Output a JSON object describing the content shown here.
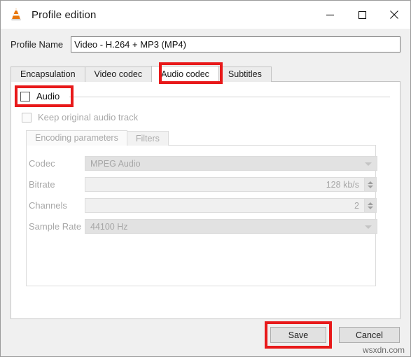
{
  "window": {
    "title": "Profile edition",
    "app_icon": "vlc-cone-icon",
    "controls": {
      "minimize": "minimize-icon",
      "maximize": "maximize-icon",
      "close": "close-icon"
    }
  },
  "profile": {
    "label": "Profile Name",
    "value": "Video - H.264 + MP3 (MP4)",
    "placeholder": ""
  },
  "tabs": [
    {
      "label": "Encapsulation",
      "active": false
    },
    {
      "label": "Video codec",
      "active": false
    },
    {
      "label": "Audio codec",
      "active": true
    },
    {
      "label": "Subtitles",
      "active": false
    }
  ],
  "audio_group": {
    "checkbox_label": "Audio",
    "checked": false,
    "keep_original_label": "Keep original audio track",
    "keep_original_checked": false,
    "keep_original_disabled": true
  },
  "inner_tabs": [
    {
      "label": "Encoding parameters",
      "active": true
    },
    {
      "label": "Filters",
      "active": false
    }
  ],
  "fields": {
    "codec": {
      "label": "Codec",
      "value": "MPEG Audio",
      "type": "combobox",
      "disabled": true
    },
    "bitrate": {
      "label": "Bitrate",
      "value": "128 kb/s",
      "type": "spinbox",
      "disabled": true
    },
    "channels": {
      "label": "Channels",
      "value": "2",
      "type": "spinbox",
      "disabled": true
    },
    "sample_rate": {
      "label": "Sample Rate",
      "value": "44100 Hz",
      "type": "combobox",
      "disabled": true
    }
  },
  "footer": {
    "save_label": "Save",
    "cancel_label": "Cancel"
  },
  "watermark": "wsxdn.com",
  "colors": {
    "highlight": "#e8191a",
    "window_bg": "#f0f0f0",
    "panel_bg": "#ffffff",
    "disabled_text": "#a8a8a8"
  }
}
